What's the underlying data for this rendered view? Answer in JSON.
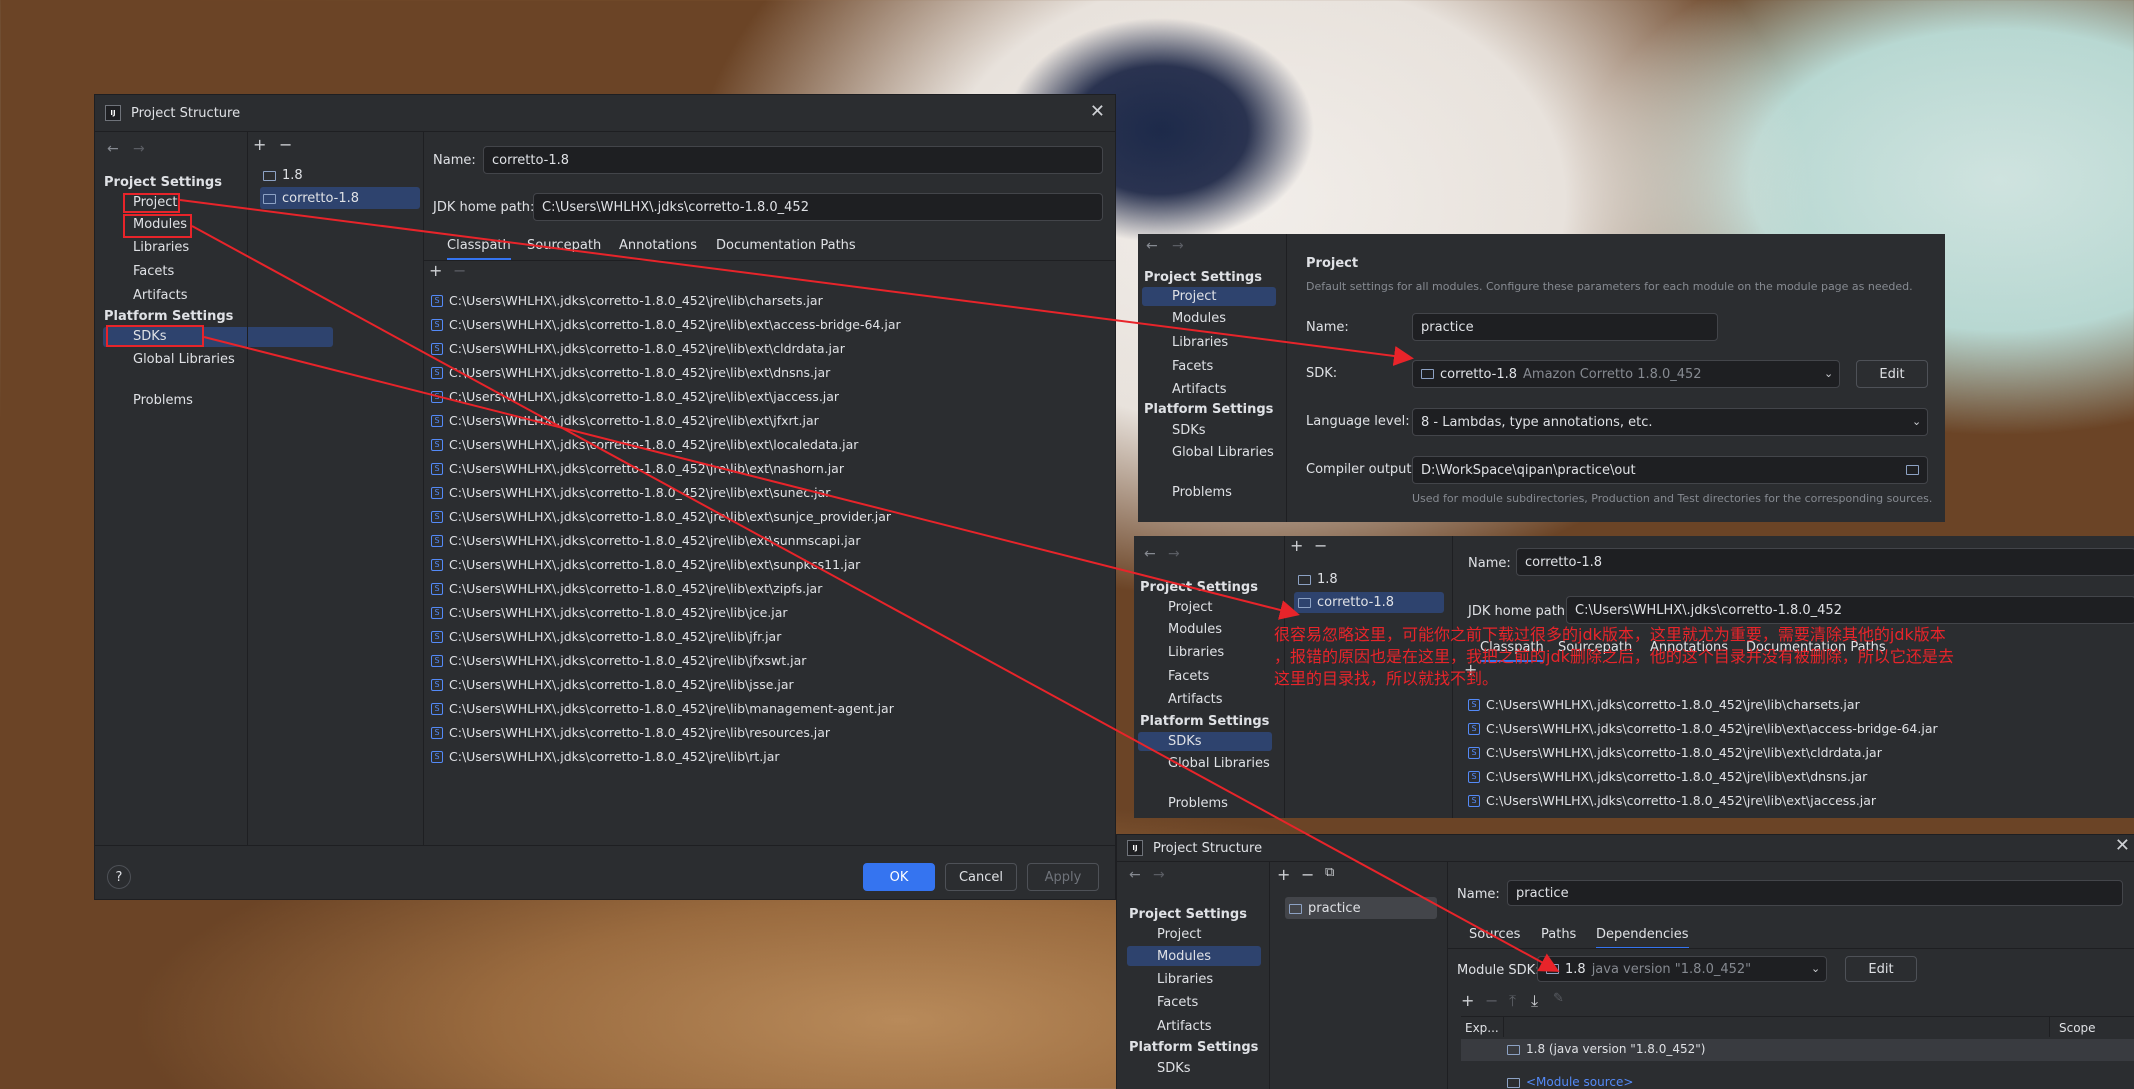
{
  "main_dialog": {
    "title": "Project Structure",
    "nav": {
      "back": "←",
      "forward": "→"
    },
    "project_settings_header": "Project Settings",
    "project_settings_items": [
      "Project",
      "Modules",
      "Libraries",
      "Facets",
      "Artifacts"
    ],
    "platform_settings_header": "Platform Settings",
    "platform_settings_items": [
      "SDKs",
      "Global Libraries"
    ],
    "problems": "Problems",
    "sdk_list": [
      "1.8",
      "corretto-1.8"
    ],
    "name_label": "Name:",
    "name_value": "corretto-1.8",
    "jdk_home_label": "JDK home path:",
    "jdk_home_value": "C:\\Users\\WHLHX\\.jdks\\corretto-1.8.0_452",
    "tabs": [
      "Classpath",
      "Sourcepath",
      "Annotations",
      "Documentation Paths"
    ],
    "classpath": [
      "C:\\Users\\WHLHX\\.jdks\\corretto-1.8.0_452\\jre\\lib\\charsets.jar",
      "C:\\Users\\WHLHX\\.jdks\\corretto-1.8.0_452\\jre\\lib\\ext\\access-bridge-64.jar",
      "C:\\Users\\WHLHX\\.jdks\\corretto-1.8.0_452\\jre\\lib\\ext\\cldrdata.jar",
      "C:\\Users\\WHLHX\\.jdks\\corretto-1.8.0_452\\jre\\lib\\ext\\dnsns.jar",
      "C:\\Users\\WHLHX\\.jdks\\corretto-1.8.0_452\\jre\\lib\\ext\\jaccess.jar",
      "C:\\Users\\WHLHX\\.jdks\\corretto-1.8.0_452\\jre\\lib\\ext\\jfxrt.jar",
      "C:\\Users\\WHLHX\\.jdks\\corretto-1.8.0_452\\jre\\lib\\ext\\localedata.jar",
      "C:\\Users\\WHLHX\\.jdks\\corretto-1.8.0_452\\jre\\lib\\ext\\nashorn.jar",
      "C:\\Users\\WHLHX\\.jdks\\corretto-1.8.0_452\\jre\\lib\\ext\\sunec.jar",
      "C:\\Users\\WHLHX\\.jdks\\corretto-1.8.0_452\\jre\\lib\\ext\\sunjce_provider.jar",
      "C:\\Users\\WHLHX\\.jdks\\corretto-1.8.0_452\\jre\\lib\\ext\\sunmscapi.jar",
      "C:\\Users\\WHLHX\\.jdks\\corretto-1.8.0_452\\jre\\lib\\ext\\sunpkcs11.jar",
      "C:\\Users\\WHLHX\\.jdks\\corretto-1.8.0_452\\jre\\lib\\ext\\zipfs.jar",
      "C:\\Users\\WHLHX\\.jdks\\corretto-1.8.0_452\\jre\\lib\\jce.jar",
      "C:\\Users\\WHLHX\\.jdks\\corretto-1.8.0_452\\jre\\lib\\jfr.jar",
      "C:\\Users\\WHLHX\\.jdks\\corretto-1.8.0_452\\jre\\lib\\jfxswt.jar",
      "C:\\Users\\WHLHX\\.jdks\\corretto-1.8.0_452\\jre\\lib\\jsse.jar",
      "C:\\Users\\WHLHX\\.jdks\\corretto-1.8.0_452\\jre\\lib\\management-agent.jar",
      "C:\\Users\\WHLHX\\.jdks\\corretto-1.8.0_452\\jre\\lib\\resources.jar",
      "C:\\Users\\WHLHX\\.jdks\\corretto-1.8.0_452\\jre\\lib\\rt.jar"
    ],
    "help": "?",
    "ok": "OK",
    "cancel": "Cancel",
    "apply": "Apply"
  },
  "project_panel": {
    "title": "Project",
    "subtitle": "Default settings for all modules. Configure these parameters for each module on the module page as needed.",
    "name_label": "Name:",
    "name_value": "practice",
    "sdk_label": "SDK:",
    "sdk_name": "corretto-1.8",
    "sdk_detail": "Amazon Corretto 1.8.0_452",
    "edit": "Edit",
    "language_level_label": "Language level:",
    "language_level_value": "8 - Lambdas, type annotations, etc.",
    "compiler_output_label": "Compiler output:",
    "compiler_output_value": "D:\\WorkSpace\\qipan\\practice\\out",
    "compiler_hint": "Used for module subdirectories, Production and Test directories for the corresponding sources."
  },
  "sdk_panel": {
    "jdk_home_value": "C:\\Users\\WHLHX\\.jdks\\corretto-1.8.0_452",
    "classpath": [
      "C:\\Users\\WHLHX\\.jdks\\corretto-1.8.0_452\\jre\\lib\\charsets.jar",
      "C:\\Users\\WHLHX\\.jdks\\corretto-1.8.0_452\\jre\\lib\\ext\\access-bridge-64.jar",
      "C:\\Users\\WHLHX\\.jdks\\corretto-1.8.0_452\\jre\\lib\\ext\\cldrdata.jar",
      "C:\\Users\\WHLHX\\.jdks\\corretto-1.8.0_452\\jre\\lib\\ext\\dnsns.jar",
      "C:\\Users\\WHLHX\\.jdks\\corretto-1.8.0_452\\jre\\lib\\ext\\jaccess.jar"
    ]
  },
  "modules_dialog": {
    "title": "Project Structure",
    "module_name": "practice",
    "name_label": "Name:",
    "name_value": "practice",
    "tabs": [
      "Sources",
      "Paths",
      "Dependencies"
    ],
    "module_sdk_label": "Module SDK:",
    "module_sdk_name": "1.8",
    "module_sdk_detail": "java version \"1.8.0_452\"",
    "edit": "Edit",
    "col_export": "Exp...",
    "col_scope": "Scope",
    "dep_sdk": "1.8 (java version \"1.8.0_452\")",
    "dep_module_source": "<Module source>"
  },
  "annotation": {
    "line1": "很容易忽略这里，可能你之前下载过很多的jdk版本，这里就尤为重要，需要清除其他的jdk版本",
    "line2": "，报错的原因也是在这里，我把之前的jdk删除之后，他的这个目录并没有被删除，所以它还是去",
    "line3": "这里的目录找，所以就找不到。"
  },
  "colors": {
    "panel_bg": "#2b2d30",
    "selection": "#2e436e",
    "accent": "#3574f0",
    "annotation_red": "#e8242a"
  }
}
